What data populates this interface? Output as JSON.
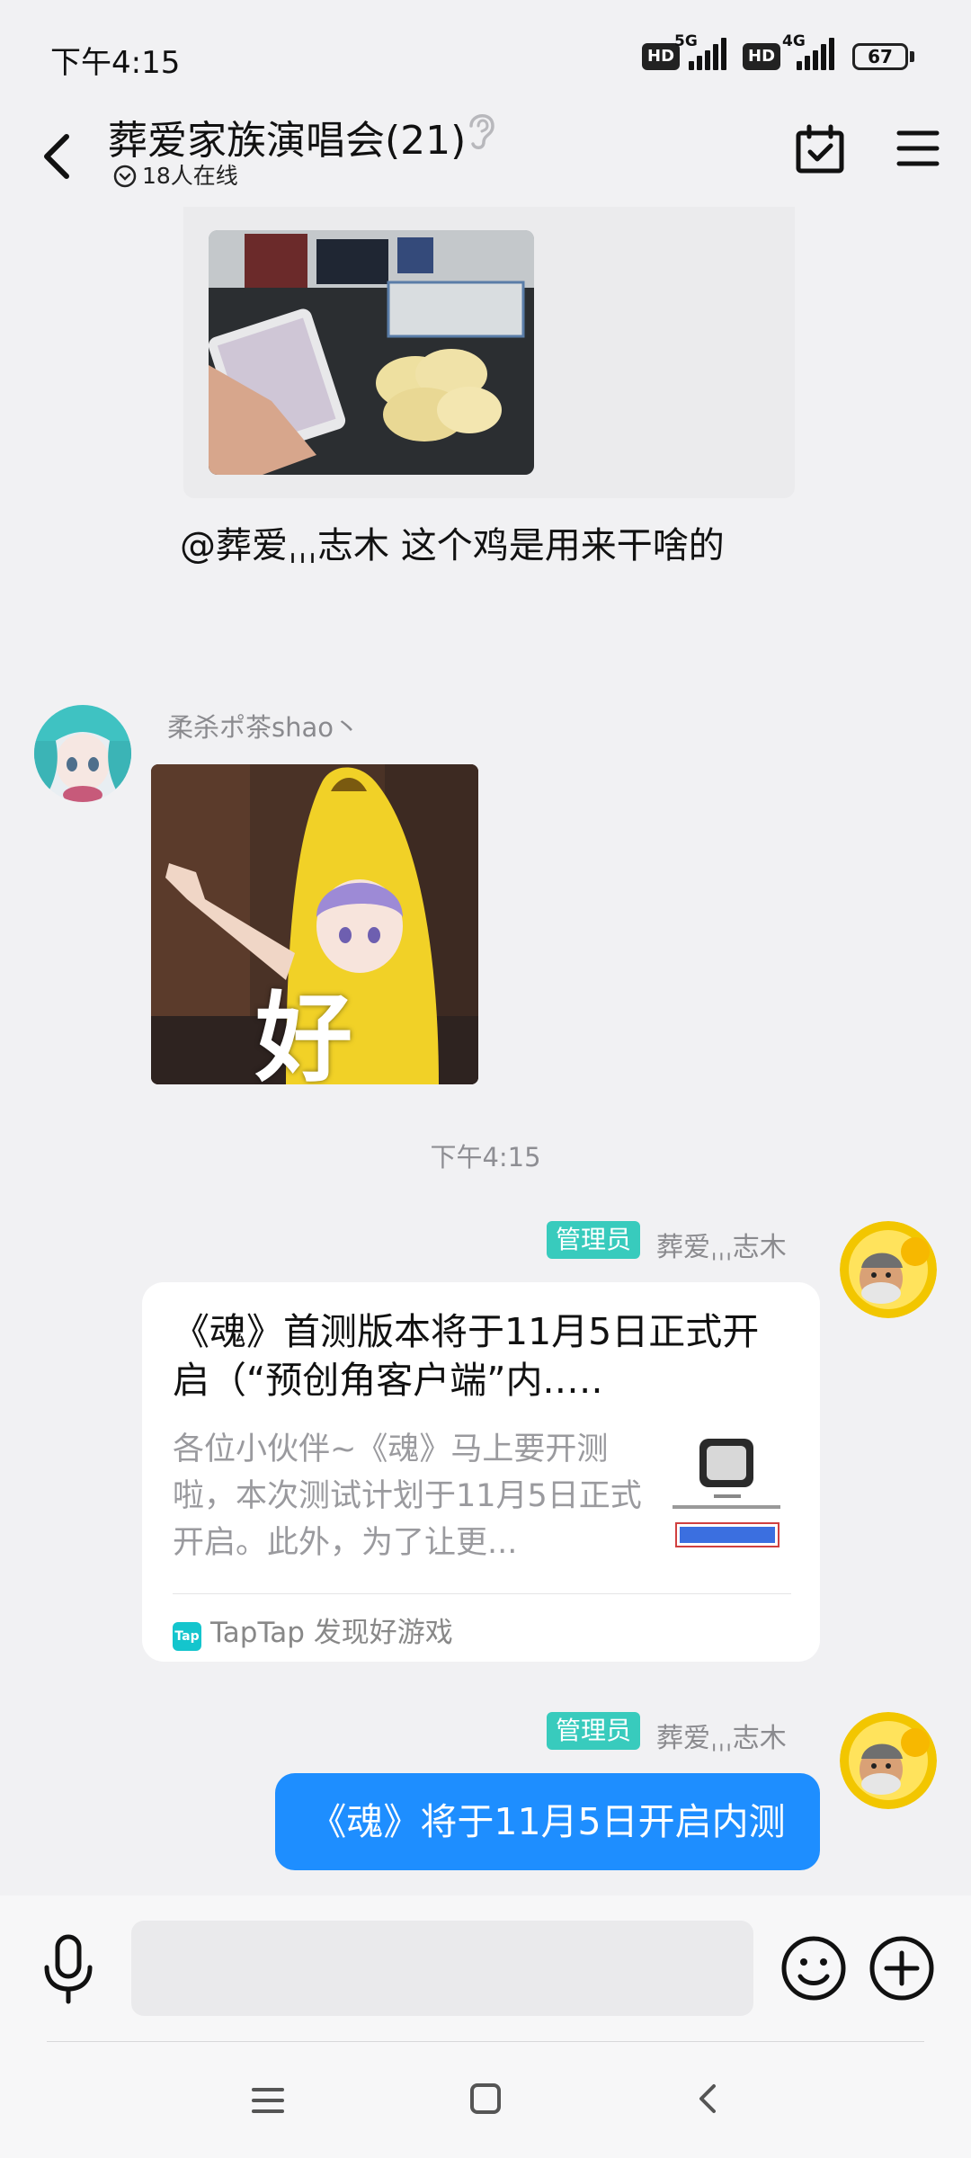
{
  "status_bar": {
    "time": "下午4:15",
    "hd1": "HD",
    "net1": "5G",
    "hd2": "HD",
    "net2": "4G",
    "battery": "67"
  },
  "header": {
    "title": "葬爱家族演唱会(21)",
    "online": "18人在线"
  },
  "messages": {
    "msg1_text": "@葬爱ˌˌˌ志木 这个鸡是用来干啥的",
    "sender_rou": "柔杀ポ茶shao丶",
    "sticker_text": "好",
    "timestamp": "下午4:15",
    "admin_badge": "管理员",
    "admin_name": "葬爱ˌˌˌ志木",
    "card": {
      "title": "《魂》首测版本将于11月5日正式开启（“预创角客户端”内.….",
      "desc": "各位小伙伴~《魂》马上要开测啦，本次测试计划于11月5日正式开启。此外，为了让更...",
      "source": "TapTap 发现好游戏",
      "tap_icon": "Tap"
    },
    "blue_text": "《魂》将于11月5日开启内测"
  },
  "colors": {
    "accent_blue": "#1e8eff",
    "admin_badge": "#38cbbd",
    "background": "#f1f1f3"
  }
}
